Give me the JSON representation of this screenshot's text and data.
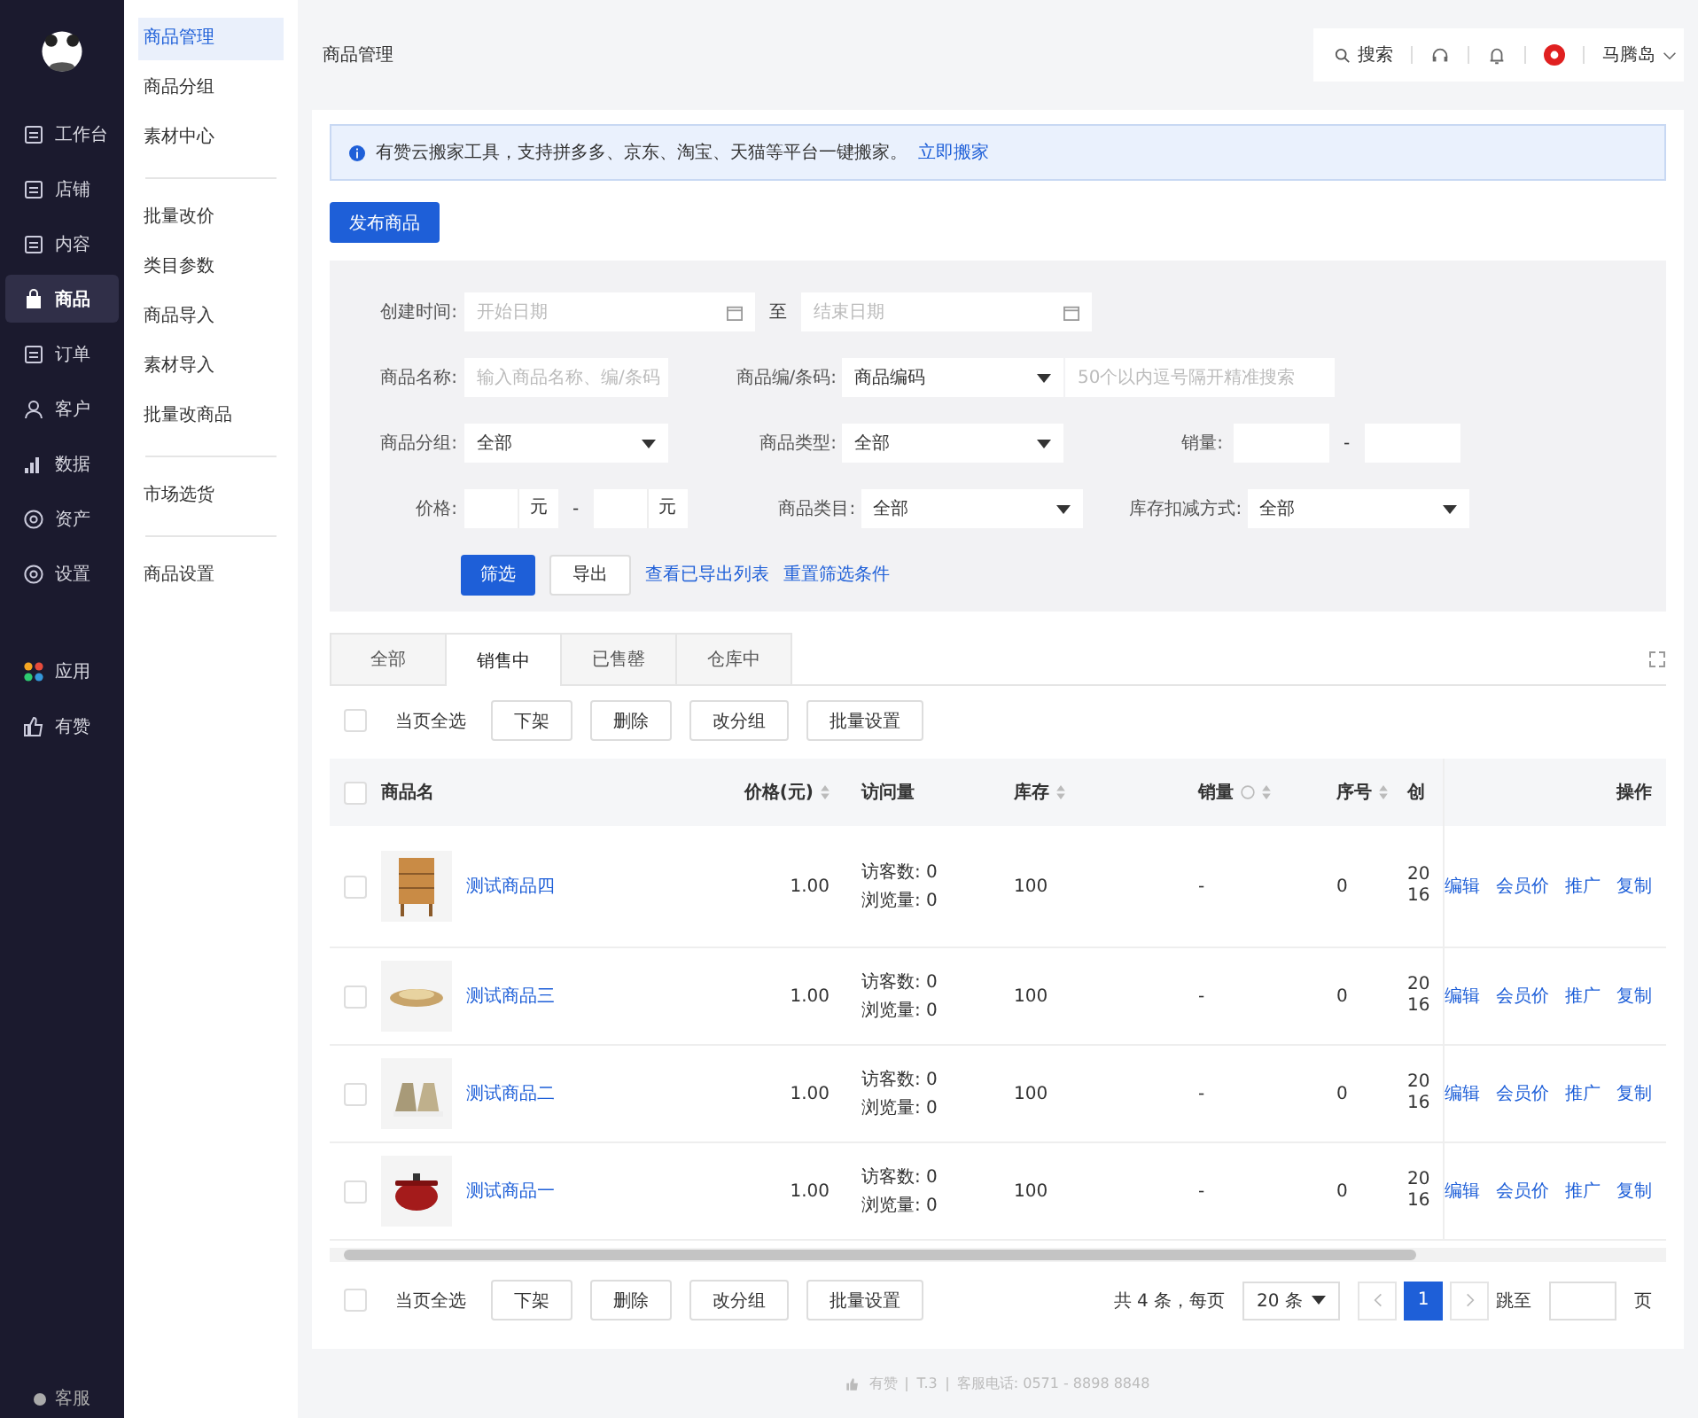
{
  "sidebar": {
    "items": [
      {
        "label": "工作台",
        "selected": false
      },
      {
        "label": "店铺",
        "selected": false
      },
      {
        "label": "内容",
        "selected": false
      },
      {
        "label": "商品",
        "selected": true
      },
      {
        "label": "订单",
        "selected": false
      },
      {
        "label": "客户",
        "selected": false
      },
      {
        "label": "数据",
        "selected": false
      },
      {
        "label": "资产",
        "selected": false
      },
      {
        "label": "设置",
        "selected": false
      }
    ],
    "apps": [
      {
        "label": "应用"
      },
      {
        "label": "有赞"
      }
    ],
    "service": "客服"
  },
  "subnav": {
    "groups": [
      [
        {
          "label": "商品管理",
          "selected": true
        },
        {
          "label": "商品分组",
          "selected": false
        },
        {
          "label": "素材中心",
          "selected": false
        }
      ],
      [
        {
          "label": "批量改价",
          "selected": false
        },
        {
          "label": "类目参数",
          "selected": false
        },
        {
          "label": "商品导入",
          "selected": false
        },
        {
          "label": "素材导入",
          "selected": false
        },
        {
          "label": "批量改商品",
          "selected": false
        }
      ],
      [
        {
          "label": "市场选货",
          "selected": false
        }
      ],
      [
        {
          "label": "商品设置",
          "selected": false
        }
      ]
    ]
  },
  "header": {
    "title": "商品管理",
    "search": "搜索",
    "user": "马腾岛"
  },
  "notice": {
    "text": "有赞云搬家工具，支持拼多多、京东、淘宝、天猫等平台一键搬家。",
    "link": "立即搬家"
  },
  "publish_button": "发布商品",
  "filters": {
    "created": {
      "label": "创建时间:",
      "start_placeholder": "开始日期",
      "separator": "至",
      "end_placeholder": "结束日期"
    },
    "name": {
      "label": "商品名称:",
      "placeholder": "输入商品名称、编/条码"
    },
    "code": {
      "label": "商品编/条码:",
      "value": "商品编码",
      "placeholder": "50个以内逗号隔开精准搜索"
    },
    "group": {
      "label": "商品分组:",
      "value": "全部"
    },
    "type": {
      "label": "商品类型:",
      "value": "全部"
    },
    "sales": {
      "label": "销量:",
      "separator": "-"
    },
    "price": {
      "label": "价格:",
      "unit_min": "元",
      "separator": "-",
      "unit_max": "元"
    },
    "category": {
      "label": "商品类目:",
      "value": "全部"
    },
    "stock_mode": {
      "label": "库存扣减方式:",
      "value": "全部"
    },
    "actions": {
      "filter": "筛选",
      "export": "导出",
      "view_exports": "查看已导出列表",
      "reset": "重置筛选条件"
    }
  },
  "tabs": [
    {
      "label": "全部",
      "selected": false
    },
    {
      "label": "销售中",
      "selected": true
    },
    {
      "label": "已售罄",
      "selected": false
    },
    {
      "label": "仓库中",
      "selected": false
    }
  ],
  "toolbar": {
    "select_all": "当页全选",
    "checked": false,
    "buttons": [
      "下架",
      "删除",
      "改分组",
      "批量设置"
    ]
  },
  "table": {
    "header_checked": false,
    "columns": [
      "商品名",
      "价格(元)",
      "访问量",
      "库存",
      "销量",
      "序号",
      "创",
      "操作"
    ],
    "rows": [
      {
        "name": "测试商品四",
        "checked": false,
        "price": "1.00",
        "visitors": "访客数: 0",
        "views": "浏览量: 0",
        "stock": "100",
        "sales": "-",
        "order": "0",
        "created": "2016",
        "actions": [
          "编辑",
          "会员价",
          "推广",
          "复制"
        ]
      },
      {
        "name": "测试商品三",
        "checked": false,
        "price": "1.00",
        "visitors": "访客数: 0",
        "views": "浏览量: 0",
        "stock": "100",
        "sales": "-",
        "order": "0",
        "created": "2016",
        "actions": [
          "编辑",
          "会员价",
          "推广",
          "复制"
        ]
      },
      {
        "name": "测试商品二",
        "checked": false,
        "price": "1.00",
        "visitors": "访客数: 0",
        "views": "浏览量: 0",
        "stock": "100",
        "sales": "-",
        "order": "0",
        "created": "2016",
        "actions": [
          "编辑",
          "会员价",
          "推广",
          "复制"
        ]
      },
      {
        "name": "测试商品一",
        "checked": false,
        "price": "1.00",
        "visitors": "访客数: 0",
        "views": "浏览量: 0",
        "stock": "100",
        "sales": "-",
        "order": "0",
        "created": "2016",
        "actions": [
          "编辑",
          "会员价",
          "推广",
          "复制"
        ]
      }
    ]
  },
  "bottom_toolbar": {
    "select_all": "当页全选",
    "checked": false,
    "buttons": [
      "下架",
      "删除",
      "改分组",
      "批量设置"
    ]
  },
  "pagination": {
    "total": "共 4 条，每页",
    "page_size": "20 条",
    "pages": [
      {
        "label": "1",
        "selected": true
      }
    ],
    "jump": "跳至",
    "page_unit": "页"
  },
  "footer": {
    "items": [
      "有赞",
      "T.3",
      "客服电话: 0571 - 8898 8848"
    ]
  }
}
